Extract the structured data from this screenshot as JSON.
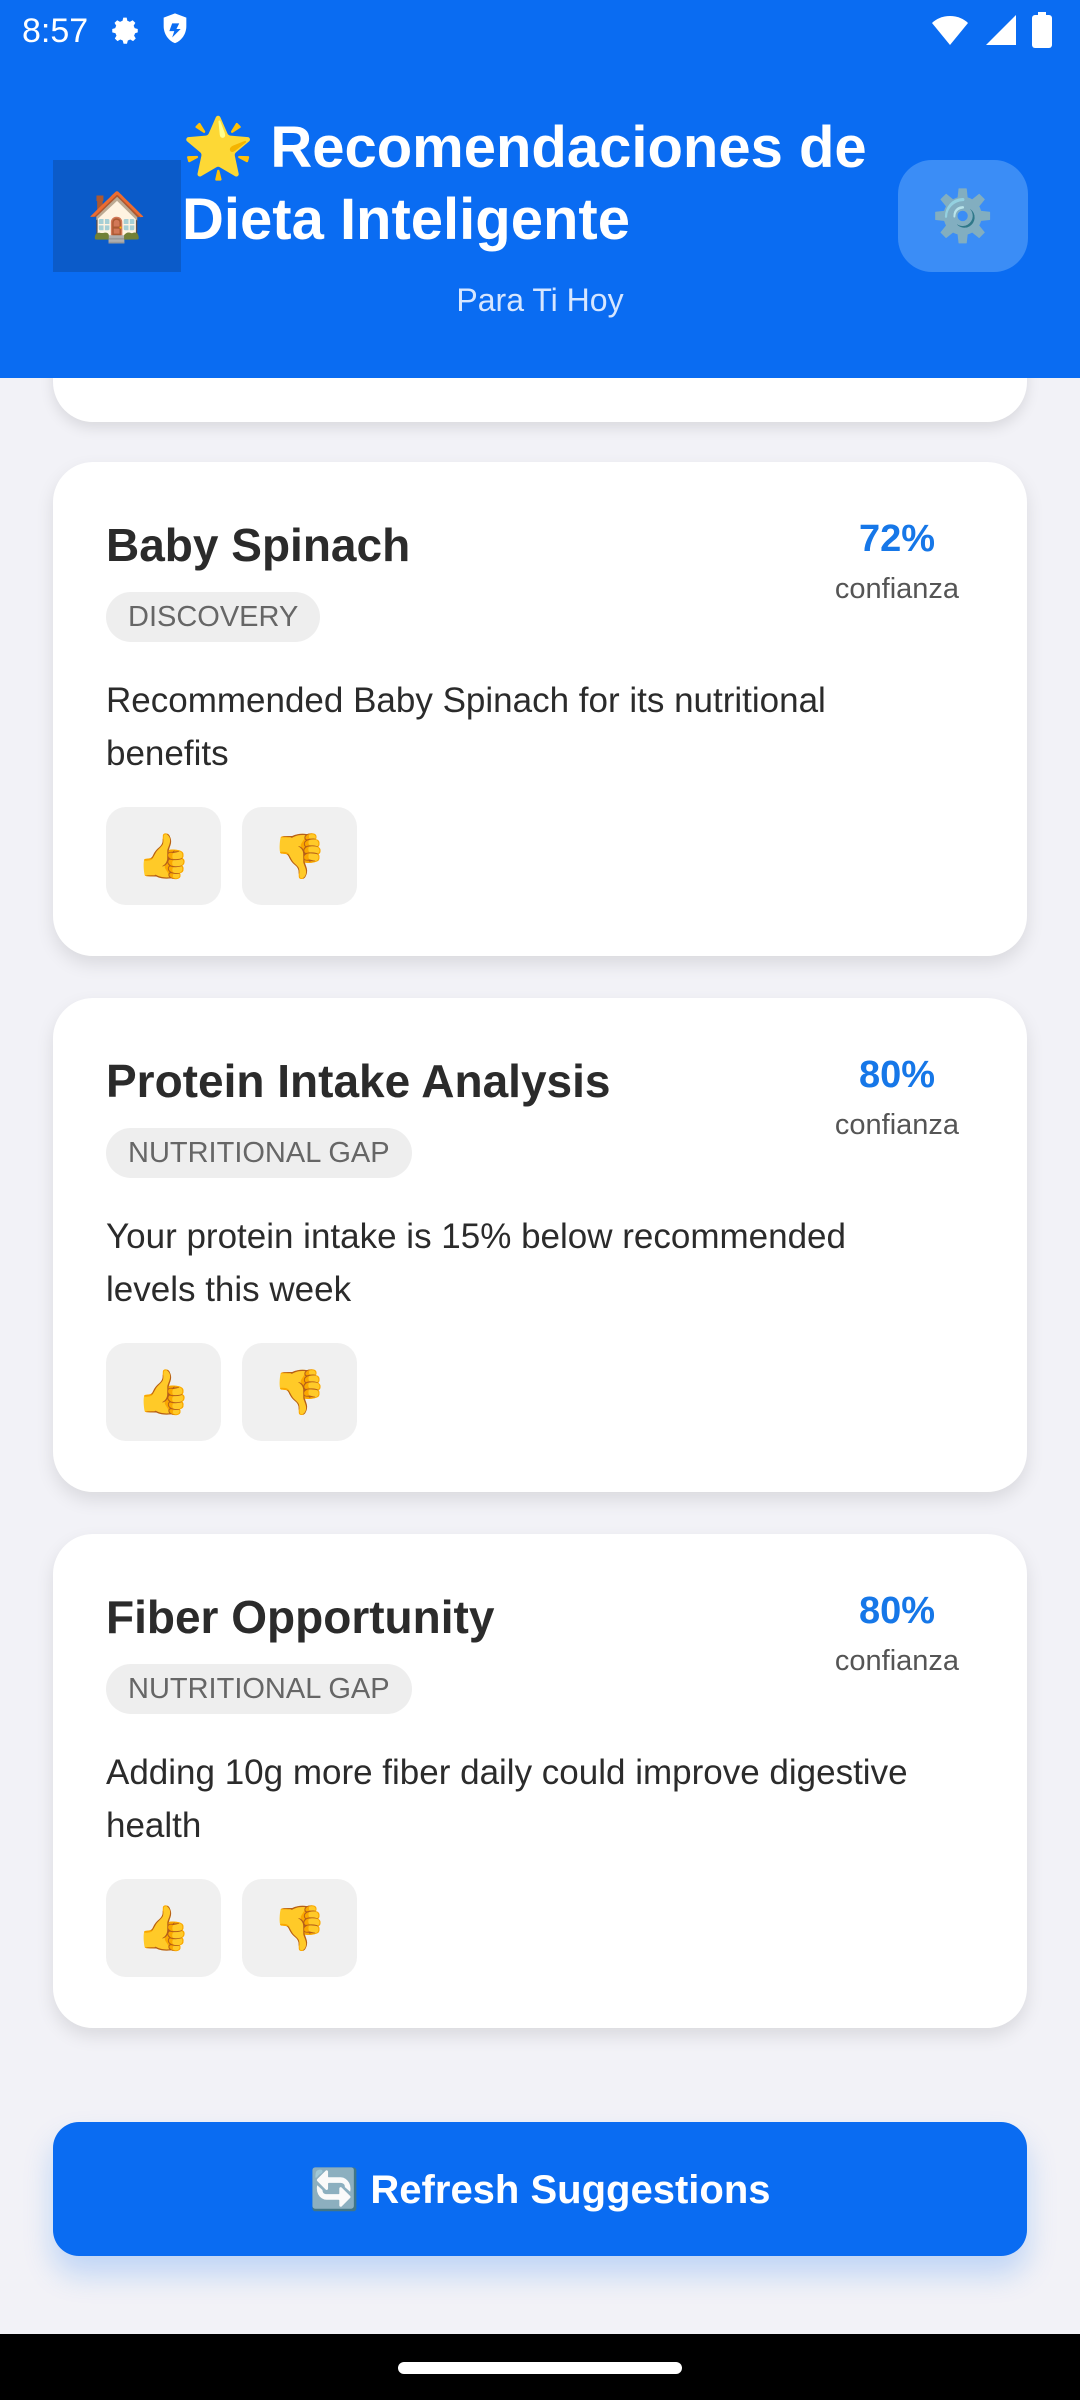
{
  "status_bar": {
    "time": "8:57",
    "icons_left": [
      "gear-icon",
      "shield-icon"
    ],
    "icons_right": [
      "wifi-icon",
      "signal-icon",
      "battery-icon"
    ]
  },
  "header": {
    "home_icon": "🏠",
    "title": "🌟 Recomendaciones de Dieta Inteligente",
    "subtitle": "Para Ti Hoy",
    "settings_icon": "⚙️"
  },
  "cards": [
    {
      "title": "Baby Spinach",
      "badge": "DISCOVERY",
      "confidence": "72%",
      "confidence_label": "confianza",
      "description": "Recommended Baby Spinach for its nutritional\nbenefits",
      "thumbs_up": "👍",
      "thumbs_down": "👎"
    },
    {
      "title": "Protein Intake Analysis",
      "badge": "NUTRITIONAL GAP",
      "confidence": "80%",
      "confidence_label": "confianza",
      "description": "Your protein intake is 15% below recommended\nlevels this week",
      "thumbs_up": "👍",
      "thumbs_down": "👎"
    },
    {
      "title": "Fiber Opportunity",
      "badge": "NUTRITIONAL GAP",
      "confidence": "80%",
      "confidence_label": "confianza",
      "description": "Adding 10g more fiber daily could improve digestive\nhealth",
      "thumbs_up": "👍",
      "thumbs_down": "👎"
    }
  ],
  "refresh_button": {
    "label": "🔄 Refresh Suggestions"
  },
  "colors": {
    "primary": "#0a6cf2",
    "confidence": "#1677e8",
    "background": "#f2f2f7"
  }
}
